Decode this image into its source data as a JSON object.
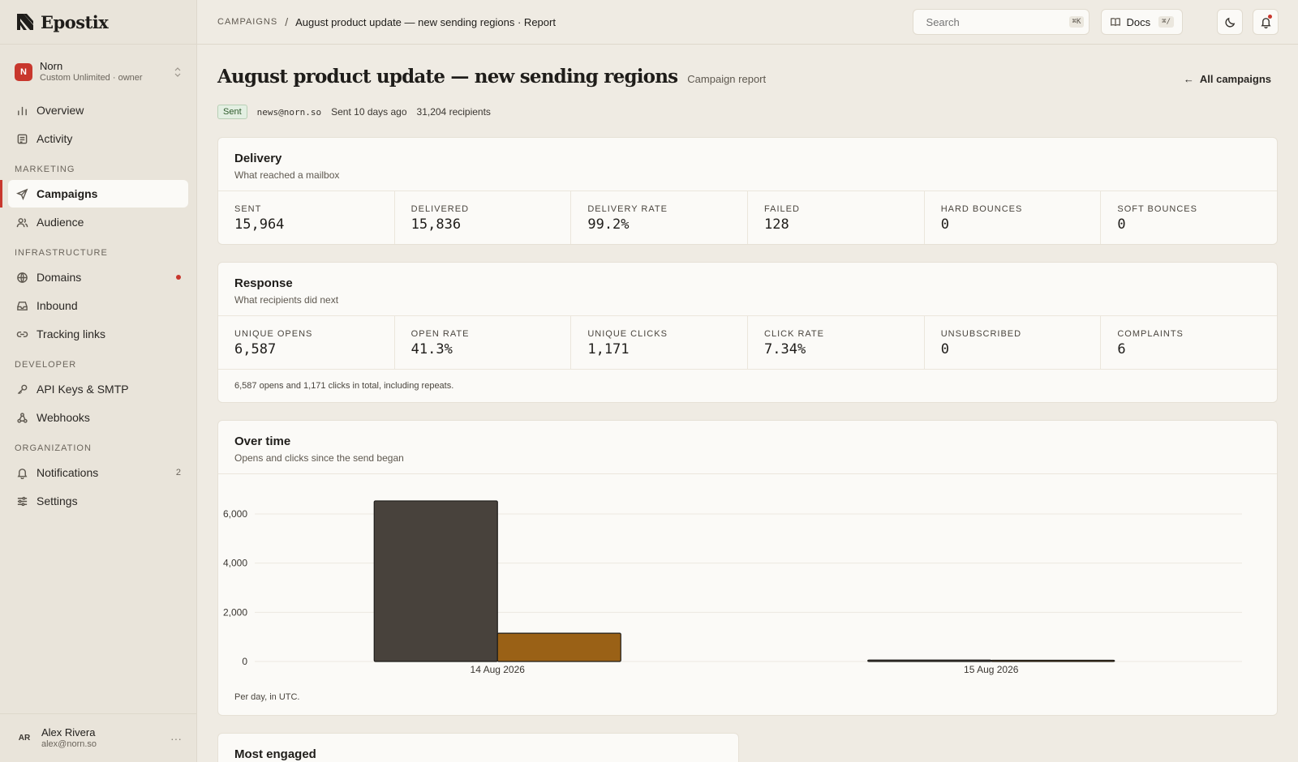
{
  "brand": {
    "name": "Epostix"
  },
  "workspace": {
    "initial": "N",
    "name": "Norn",
    "plan": "Custom Unlimited · owner"
  },
  "nav": {
    "top": [
      {
        "label": "Overview",
        "icon": "bar-chart-icon"
      },
      {
        "label": "Activity",
        "icon": "list-icon"
      }
    ],
    "sections": [
      {
        "title": "MARKETING",
        "items": [
          {
            "label": "Campaigns",
            "icon": "send-icon",
            "active": true
          },
          {
            "label": "Audience",
            "icon": "users-icon"
          }
        ]
      },
      {
        "title": "INFRASTRUCTURE",
        "items": [
          {
            "label": "Domains",
            "icon": "globe-icon",
            "dot": true
          },
          {
            "label": "Inbound",
            "icon": "inbox-icon"
          },
          {
            "label": "Tracking links",
            "icon": "link-icon"
          }
        ]
      },
      {
        "title": "DEVELOPER",
        "items": [
          {
            "label": "API Keys & SMTP",
            "icon": "key-icon"
          },
          {
            "label": "Webhooks",
            "icon": "webhook-icon"
          }
        ]
      },
      {
        "title": "ORGANIZATION",
        "items": [
          {
            "label": "Notifications",
            "icon": "bell-icon",
            "count": "2"
          },
          {
            "label": "Settings",
            "icon": "sliders-icon"
          }
        ]
      }
    ]
  },
  "user": {
    "initials": "AR",
    "name": "Alex Rivera",
    "email": "alex@norn.so",
    "more": "···"
  },
  "topbar": {
    "breadcrumb_root": "CAMPAIGNS",
    "breadcrumb_sep": "/",
    "breadcrumb_current": "August product update — new sending regions · Report",
    "search_placeholder": "Search",
    "search_kbd": "⌘K",
    "docs_label": "Docs",
    "docs_kbd": "⌘/"
  },
  "page": {
    "title": "August product update — new sending regions",
    "subtitle": "Campaign report",
    "back_arrow": "←",
    "back_label": "All campaigns",
    "status": "Sent",
    "from": "news@norn.so",
    "sent_ago": "Sent 10 days ago",
    "recipients": "31,204 recipients"
  },
  "delivery": {
    "title": "Delivery",
    "subtitle": "What reached a mailbox",
    "stats": [
      {
        "label": "SENT",
        "value": "15,964"
      },
      {
        "label": "DELIVERED",
        "value": "15,836"
      },
      {
        "label": "DELIVERY RATE",
        "value": "99.2%"
      },
      {
        "label": "FAILED",
        "value": "128"
      },
      {
        "label": "HARD BOUNCES",
        "value": "0"
      },
      {
        "label": "SOFT BOUNCES",
        "value": "0"
      }
    ]
  },
  "response": {
    "title": "Response",
    "subtitle": "What recipients did next",
    "stats": [
      {
        "label": "UNIQUE OPENS",
        "value": "6,587"
      },
      {
        "label": "OPEN RATE",
        "value": "41.3%"
      },
      {
        "label": "UNIQUE CLICKS",
        "value": "1,171"
      },
      {
        "label": "CLICK RATE",
        "value": "7.34%"
      },
      {
        "label": "UNSUBSCRIBED",
        "value": "0"
      },
      {
        "label": "COMPLAINTS",
        "value": "6"
      }
    ],
    "note": "6,587 opens and 1,171 clicks in total, including repeats."
  },
  "over_time": {
    "title": "Over time",
    "subtitle": "Opens and clicks since the send began",
    "footnote": "Per day, in UTC."
  },
  "most_engaged": {
    "title": "Most engaged"
  },
  "chart_data": {
    "type": "bar",
    "categories": [
      "14 Aug 2026",
      "15 Aug 2026"
    ],
    "series": [
      {
        "values": [
          6530,
          60
        ],
        "color": "#48423c"
      },
      {
        "values": [
          1150,
          20
        ],
        "color": "#9a6116"
      }
    ],
    "yticks": [
      "0",
      "2,000",
      "4,000",
      "6,000"
    ],
    "ylim": [
      0,
      6800
    ],
    "grid": true,
    "xlabel": "",
    "ylabel": ""
  }
}
